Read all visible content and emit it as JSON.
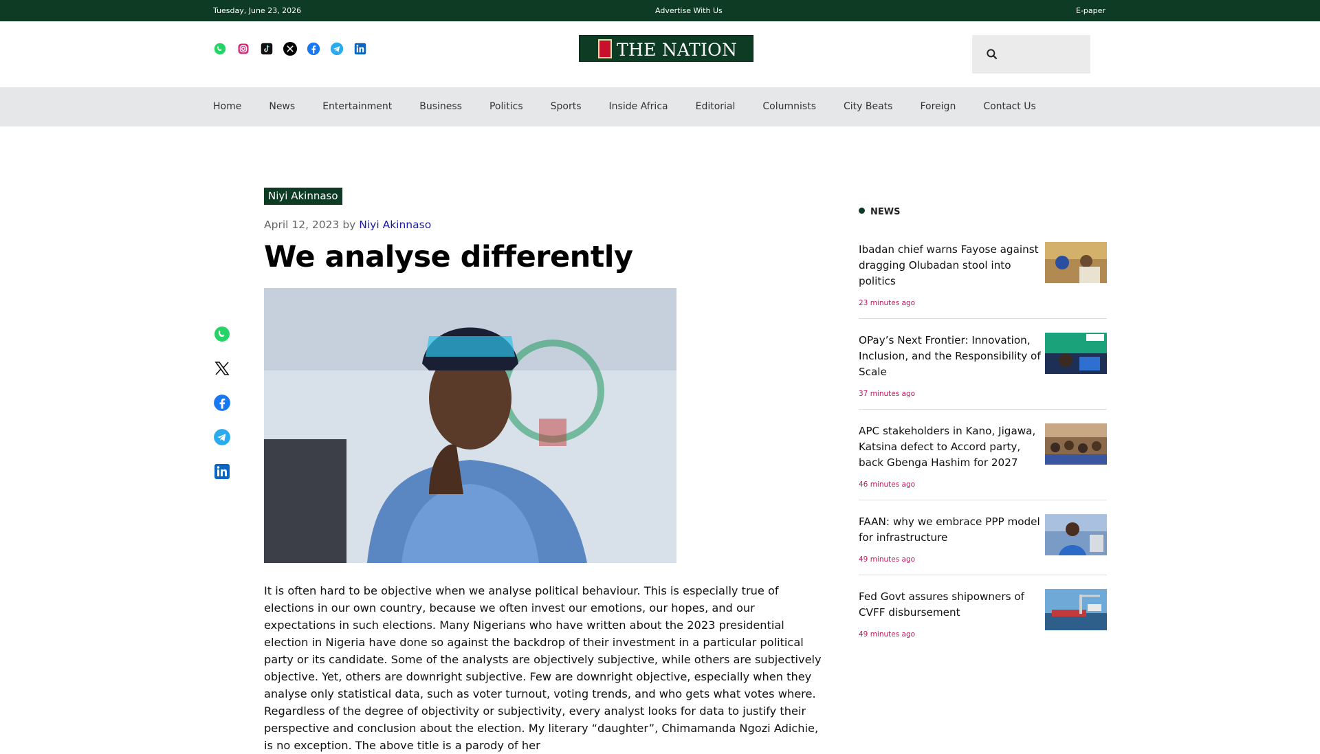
{
  "topbar": {
    "date": "Tuesday, June 23, 2026",
    "advertise": "Advertise With Us",
    "epaper": "E-paper"
  },
  "header": {
    "logo_text": "THE NATION",
    "search_placeholder": "",
    "socials": [
      "whatsapp-icon",
      "instagram-icon",
      "tiktok-icon",
      "x-icon",
      "facebook-icon",
      "telegram-icon",
      "linkedin-icon"
    ]
  },
  "nav": [
    "Home",
    "News",
    "Entertainment",
    "Business",
    "Politics",
    "Sports",
    "Inside Africa",
    "Editorial",
    "Columnists",
    "City Beats",
    "Foreign",
    "Contact Us"
  ],
  "article": {
    "category": "Niyi Akinnaso",
    "date": "April 12, 2023",
    "by": "by",
    "author": "Niyi Akinnaso",
    "title": "We analyse differently",
    "body": "It is often hard to be objective when we analyse political behaviour. This is especially true of elections in our own country, because we often invest our emotions, our hopes, and our expectations in such elections. Many Nigerians who have written about the 2023 presidential election in Nigeria have done so against the backdrop of their investment in a particular political party or its candidate. Some of the analysts are objectively subjective, while others are subjectively objective. Yet, others are downright subjective. Few are downright objective, especially when they analyse only statistical data, such as voter turnout, voting trends, and who gets what votes where. Regardless of the degree of objectivity or subjectivity, every analyst looks for data to justify their perspective and conclusion about the election. My literary “daughter”, Chimamanda Ngozi Adichie, is no exception. The above title is a parody of her"
  },
  "share": [
    "whatsapp-icon",
    "x-icon",
    "facebook-icon",
    "telegram-icon",
    "linkedin-icon"
  ],
  "sidebar": {
    "title": "NEWS",
    "items": [
      {
        "headline": "Ibadan chief warns Fayose against dragging Olubadan stool into politics",
        "time": "23 minutes ago"
      },
      {
        "headline": "OPay’s Next Frontier: Innovation, Inclusion, and the Responsibility of Scale",
        "time": "37 minutes ago"
      },
      {
        "headline": "APC stakeholders in Kano, Jigawa, Katsina defect to Accord party, back Gbenga Hashim for 2027",
        "time": "46 minutes ago"
      },
      {
        "headline": "FAAN: why we embrace PPP model for infrastructure",
        "time": "49 minutes ago"
      },
      {
        "headline": "Fed Govt assures shipowners of CVFF disbursement",
        "time": "49 minutes ago"
      }
    ]
  },
  "colors": {
    "brand_green": "#0e3b24",
    "time_pink": "#c2185b",
    "link_blue": "#1a1aa6"
  }
}
